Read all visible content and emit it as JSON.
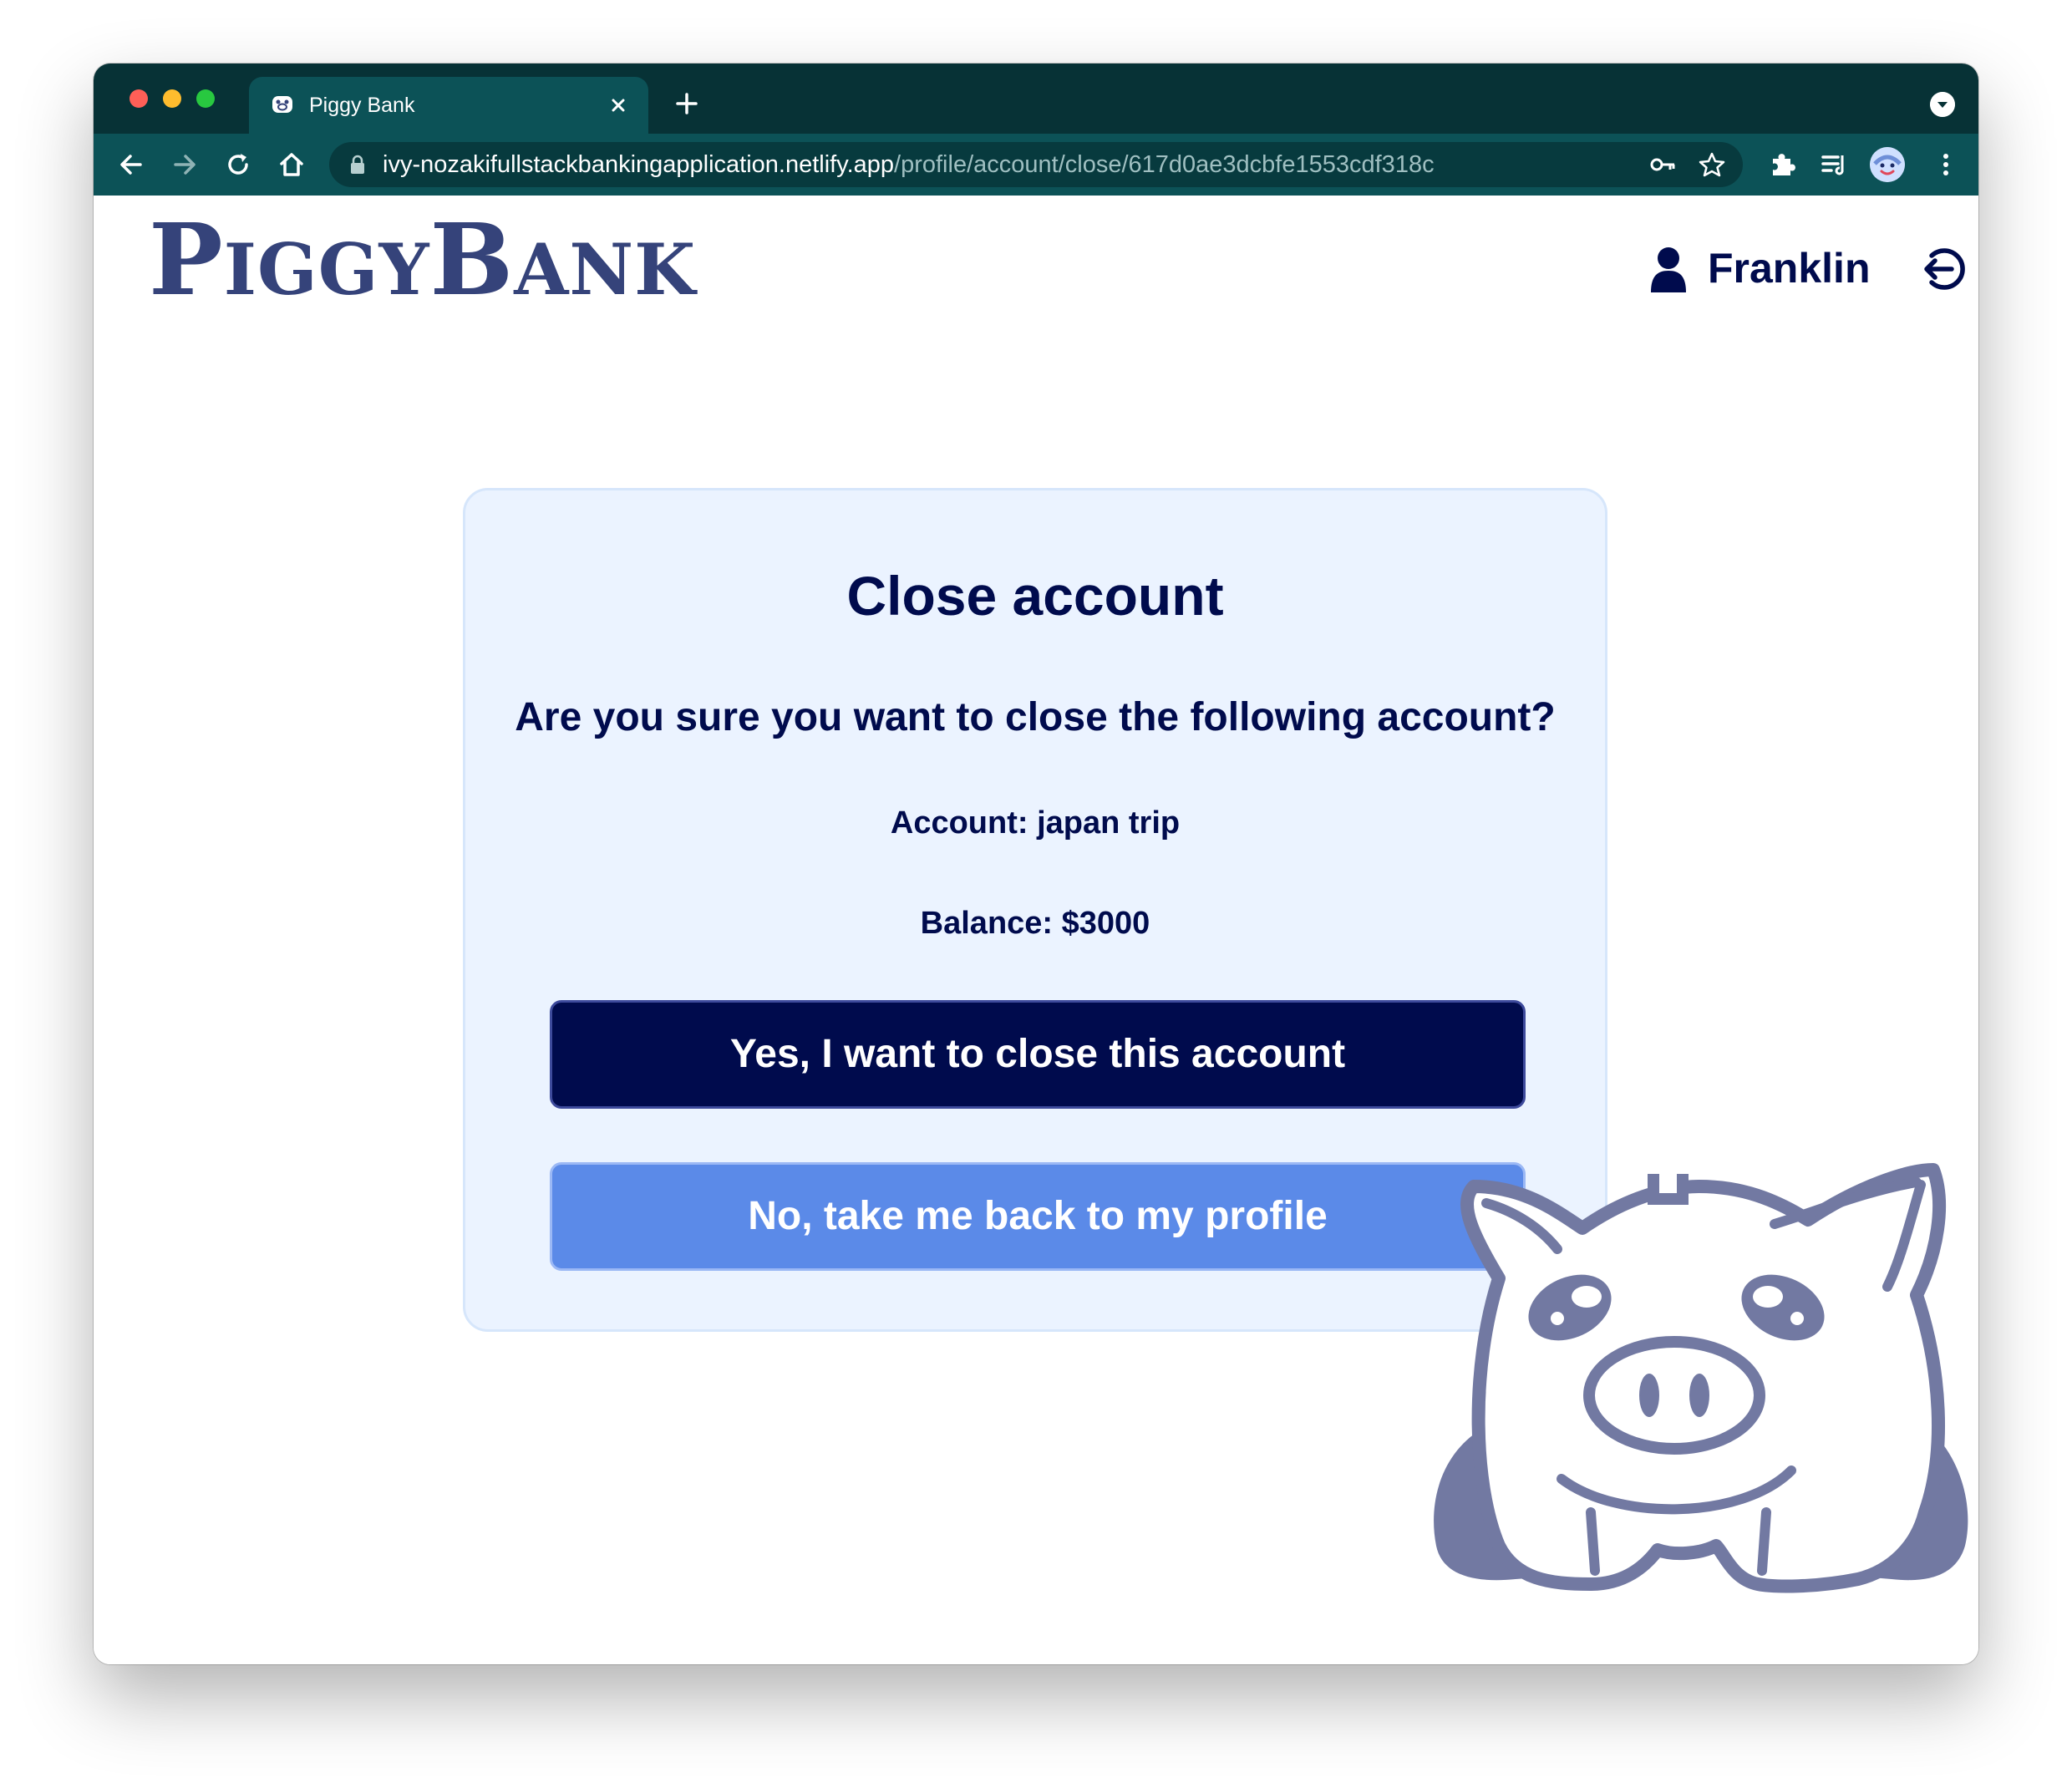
{
  "browser": {
    "tab_title": "Piggy Bank",
    "url_host": "ivy-nozakifullstackbankingapplication.netlify.app",
    "url_path": "/profile/account/close/617d0ae3dcbfe1553cdf318c"
  },
  "header": {
    "logo_first_cap": "P",
    "logo_first_rest": "IGGY",
    "logo_second_cap": "B",
    "logo_second_rest": "ANK",
    "username": "Franklin"
  },
  "card": {
    "title": "Close account",
    "question": "Are you sure you want to close the following account?",
    "account_line": "Account: japan trip",
    "balance_line": "Balance: $3000",
    "confirm_label": "Yes, I want to close this account",
    "cancel_label": "No, take me back to my profile"
  },
  "colors": {
    "navy": "#000b4d",
    "card_background": "#ebf3ff",
    "secondary_button": "#5b8ae8",
    "logo": "#35437a",
    "browser_chrome": "#0c5257"
  },
  "icons": {
    "user": "user-icon",
    "logout": "logout-icon",
    "mascot": "piggy-bank-illustration"
  }
}
